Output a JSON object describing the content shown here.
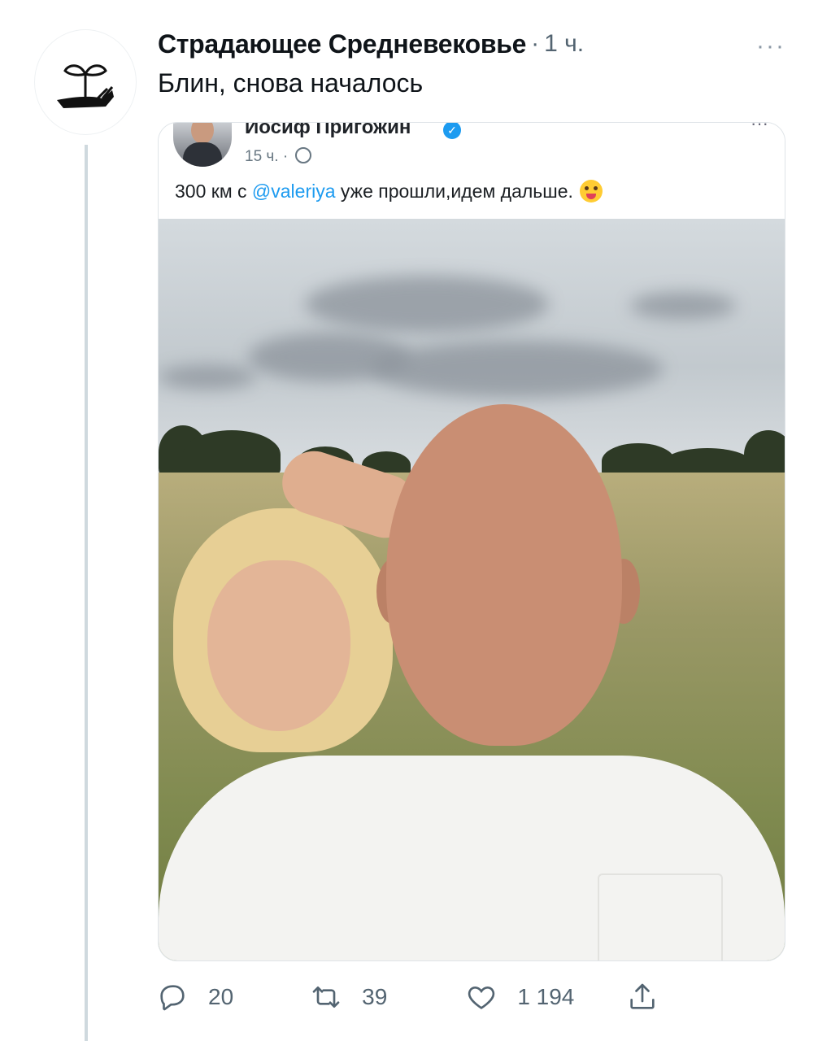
{
  "tweet": {
    "author": "Страдающее Средневековье",
    "separator": "·",
    "time": "1 ч.",
    "more": "···",
    "text": "Блин, снова началось"
  },
  "embedded": {
    "author": "Иосиф Пригожин",
    "time": "15 ч. ·",
    "text_before": "300 км с ",
    "mention": "@valeriya",
    "text_after": " уже прошли,идем дальше.",
    "more": "···"
  },
  "actions": {
    "reply_count": "20",
    "retweet_count": "39",
    "like_count": "1 194"
  },
  "colors": {
    "accent": "#1d9bf0",
    "muted": "#536471"
  },
  "icons": [
    "more-icon",
    "verified-icon",
    "globe-icon",
    "emoji-icon",
    "reply-icon",
    "retweet-icon",
    "like-icon",
    "share-icon"
  ]
}
